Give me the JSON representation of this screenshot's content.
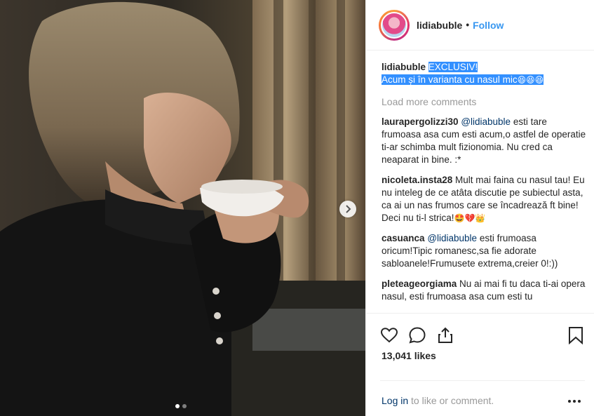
{
  "post": {
    "author": "lidiabuble",
    "follow_label": "Follow",
    "separator": "•",
    "caption_line1": "EXCLUSIV!",
    "caption_line2": "Acum și în varianta cu nasul mic",
    "caption_emojis": "😆😆😆",
    "load_more_label": "Load more comments",
    "likes": "13,041 likes",
    "login_link": "Log in",
    "login_rest": " to like or comment.",
    "carousel": {
      "slide_count": 2,
      "active_slide": 1
    }
  },
  "comments": [
    {
      "user": "laurapergolizzi30",
      "mention": "@lidiabuble",
      "text": " esti tare frumoasa asa cum esti acum,o astfel de operatie ti-ar schimba mult fizionomia. Nu cred ca neaparat in bine. :*"
    },
    {
      "user": "nicoleta.insta28",
      "mention": "",
      "text": " Mult mai faina cu nasul tau! Eu nu inteleg de ce atâta discutie pe subiectul asta, ca ai un nas frumos care se încadrează ft bine! Deci nu ti-l strica!",
      "emojis": "🤩💔👑"
    },
    {
      "user": "casuanca",
      "mention": "@lidiabuble",
      "text": " esti frumoasa oricum!Tipic romanesc,sa fie adorate sabloanele!Frumusete extrema,creier 0!:))"
    },
    {
      "user": "pleteageorgiama",
      "mention": "",
      "text": " Nu ai mai fi tu daca ti-ai opera nasul, esti frumoasa asa cum esti tu"
    }
  ],
  "icons": {
    "like": "heart-icon",
    "comment": "comment-bubble-icon",
    "share": "share-icon",
    "save": "bookmark-icon",
    "next": "chevron-right-icon",
    "more": "more-options-icon"
  },
  "colors": {
    "link_blue": "#3897f0",
    "mention_blue": "#003569",
    "selection_highlight": "#3390ff",
    "muted_text": "#999999"
  }
}
